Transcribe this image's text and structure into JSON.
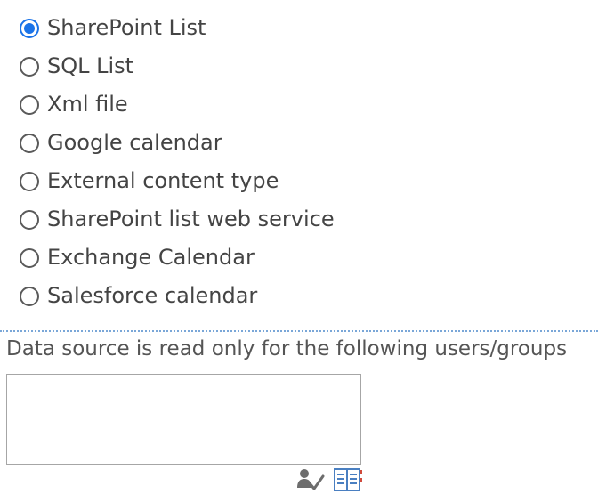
{
  "data_source_options": [
    {
      "label": "SharePoint List",
      "checked": true
    },
    {
      "label": "SQL List",
      "checked": false
    },
    {
      "label": "Xml file",
      "checked": false
    },
    {
      "label": "Google calendar",
      "checked": false
    },
    {
      "label": "External content type",
      "checked": false
    },
    {
      "label": "SharePoint list web service",
      "checked": false
    },
    {
      "label": "Exchange Calendar",
      "checked": false
    },
    {
      "label": "Salesforce calendar",
      "checked": false
    }
  ],
  "read_only_section": {
    "label": "Data source is read only for the following users/groups",
    "users_value": ""
  },
  "icons": {
    "check_names": "check-names-icon",
    "browse": "address-book-icon"
  },
  "colors": {
    "radio_selected": "#1a73e8",
    "divider": "#7aa7d8",
    "text": "#444444"
  }
}
